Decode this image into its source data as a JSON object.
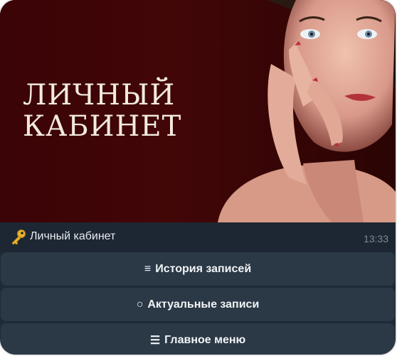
{
  "banner": {
    "title_line1": "ЛИЧНЫЙ",
    "title_line2": "КАБИНЕТ"
  },
  "message": {
    "icon": "key-icon",
    "text": "Личный кабинет",
    "time": "13:33"
  },
  "buttons": [
    {
      "icon": "≡",
      "label": "История записей"
    },
    {
      "icon": "○",
      "label": "Актуальные записи"
    },
    {
      "icon": "☰",
      "label": "Главное меню"
    }
  ]
}
